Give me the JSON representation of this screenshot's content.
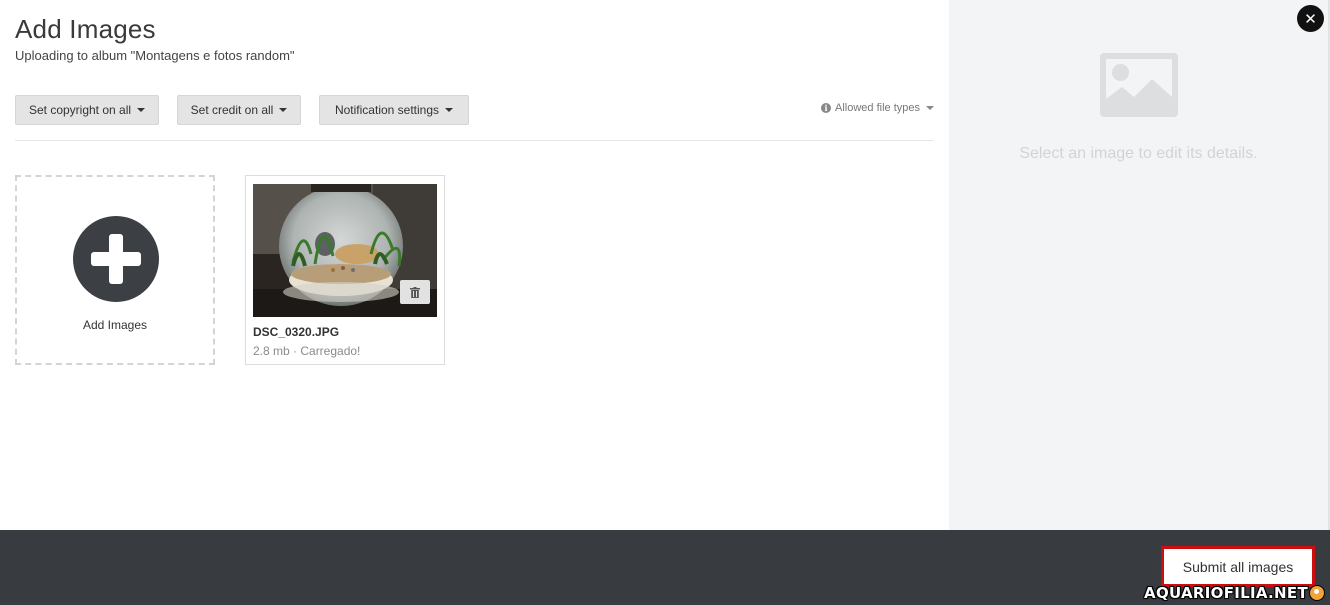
{
  "header": {
    "title": "Add Images",
    "subtitle": "Uploading to album \"Montagens e fotos random\""
  },
  "toolbar": {
    "copyright_label": "Set copyright on all",
    "credit_label": "Set credit on all",
    "notification_label": "Notification settings",
    "allowed_types_label": "Allowed file types"
  },
  "add_tile": {
    "label": "Add Images"
  },
  "file": {
    "name": "DSC_0320.JPG",
    "meta": "2.8 mb · Carregado!"
  },
  "side_panel": {
    "hint": "Select an image to edit its details."
  },
  "footer": {
    "submit_label": "Submit all images",
    "watermark": "AQUARIOFILIA.NET"
  },
  "colors": {
    "footer_bg": "#383c41",
    "submit_highlight": "#cc0e0e",
    "side_panel_bg": "#f3f4f5"
  }
}
